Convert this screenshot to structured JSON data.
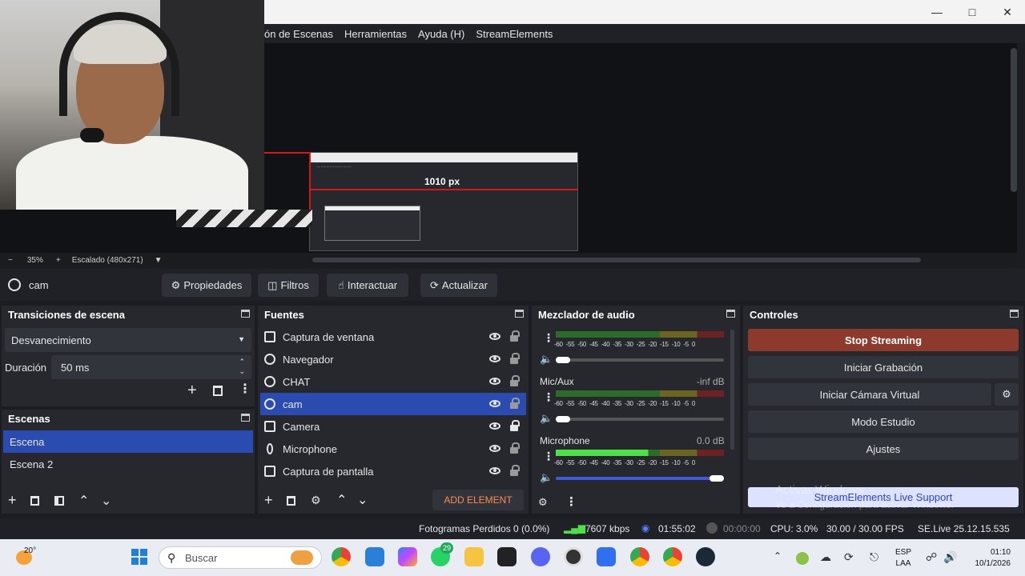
{
  "window": {
    "minimize_icon": "minimize-icon",
    "maximize_icon": "maximize-icon",
    "close_icon": "close-icon"
  },
  "menu": {
    "items": [
      "ón de Escenas",
      "Herramientas",
      "Ayuda (H)",
      "StreamElements"
    ]
  },
  "preview": {
    "px_label": "1010 px",
    "zoom": "35%",
    "scaling": "Escalado (480x271)"
  },
  "source_toolbar": {
    "selected_source": "cam",
    "properties": "Propiedades",
    "filters": "Filtros",
    "interact": "Interactuar",
    "refresh": "Actualizar"
  },
  "transitions": {
    "title": "Transiciones de escena",
    "selected": "Desvanecimiento",
    "duration_label": "Duración",
    "duration_value": "50 ms"
  },
  "scenes": {
    "title": "Escenas",
    "items": [
      "Escena",
      "Escena 2"
    ],
    "selected_index": 0
  },
  "sources": {
    "title": "Fuentes",
    "items": [
      {
        "name": "Captura de ventana",
        "icon": "window-capture-icon",
        "locked": false
      },
      {
        "name": "Navegador",
        "icon": "globe-icon",
        "locked": false
      },
      {
        "name": "CHAT",
        "icon": "globe-icon",
        "locked": false
      },
      {
        "name": "cam",
        "icon": "globe-icon",
        "locked": false,
        "selected": true
      },
      {
        "name": "Camera",
        "icon": "camera-icon",
        "locked": true
      },
      {
        "name": "Microphone",
        "icon": "microphone-icon",
        "locked": false
      },
      {
        "name": "Captura de pantalla",
        "icon": "monitor-icon",
        "locked": false
      }
    ],
    "add_element": "ADD ELEMENT"
  },
  "mixer": {
    "title": "Mezclador de audio",
    "tick_labels": [
      "-60",
      "-55",
      "-50",
      "-45",
      "-40",
      "-35",
      "-30",
      "-25",
      "-20",
      "-15",
      "-10",
      "-5",
      "0"
    ],
    "channels": [
      {
        "name": "",
        "level": "",
        "volume": 0.0
      },
      {
        "name": "Mic/Aux",
        "level": "-inf dB",
        "volume": 0.0
      },
      {
        "name": "Microphone",
        "level": "0.0 dB",
        "volume": 1.0
      }
    ]
  },
  "controls": {
    "title": "Controles",
    "stop_streaming": "Stop Streaming",
    "start_recording": "Iniciar Grabación",
    "virtual_camera": "Iniciar Cámara Virtual",
    "studio_mode": "Modo Estudio",
    "settings": "Ajustes",
    "live_support": "StreamElements Live Support"
  },
  "watermark": {
    "line1": "Activar Windows",
    "line2": "Ve a Configuración para activar Windows."
  },
  "status": {
    "dropped_frames": "Fotogramas Perdidos 0 (0.0%)",
    "bitrate": "7607 kbps",
    "stream_time": "01:55:02",
    "record_time": "00:00:00",
    "cpu": "CPU: 3.0%",
    "fps": "30.00 / 30.00 FPS",
    "version": "SE.Live 25.12.15.535"
  },
  "taskbar": {
    "weather": "20°",
    "search_placeholder": "Buscar",
    "lang1": "ESP",
    "lang2": "LAA",
    "time": "01:10",
    "date": "10/1/2026",
    "whatsapp_badge": "29"
  },
  "colors": {
    "stop_button": "#8d3a2c",
    "selection": "#2a4bb0",
    "add_element": "#ff8a4c"
  }
}
